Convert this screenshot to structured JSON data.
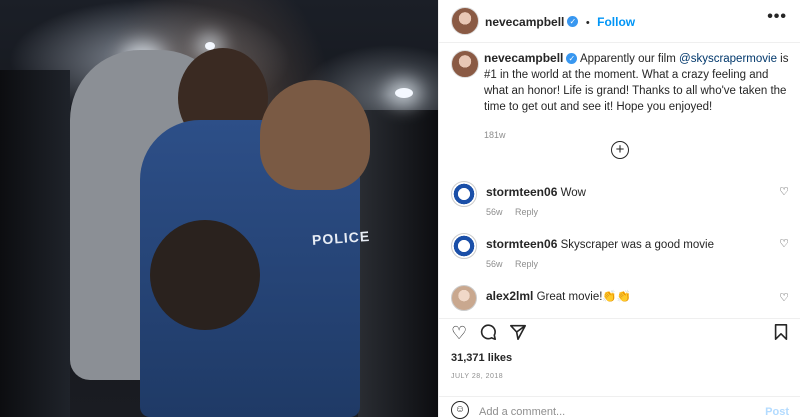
{
  "post": {
    "username": "nevecampbell",
    "follow_label": "Follow",
    "more_glyph": "•••",
    "caption_lines": [
      "Apparently our film",
      "@skyscrapermovie",
      "is #1 in the world at the moment. What a crazy feeling and what an honor! Life is grand! Thanks to all who've taken the time to get out and see it! Hope you enjoyed!"
    ],
    "caption_time": "181w",
    "photo_label": "POLICE"
  },
  "comments": [
    {
      "user": "stormteen06",
      "text": "Wow",
      "time": "56w",
      "reply": "Reply"
    },
    {
      "user": "stormteen06",
      "text": "Skyscraper was a good movie",
      "time": "56w",
      "reply": "Reply"
    },
    {
      "user": "alex2lml",
      "text": "Great movie!👏👏"
    }
  ],
  "likes": "31,371 likes",
  "date": "JULY 28, 2018",
  "add_comment": {
    "placeholder": "Add a comment...",
    "post_label": "Post"
  },
  "colors": {
    "accent": "#0095f6",
    "verified": "#3897f0"
  }
}
